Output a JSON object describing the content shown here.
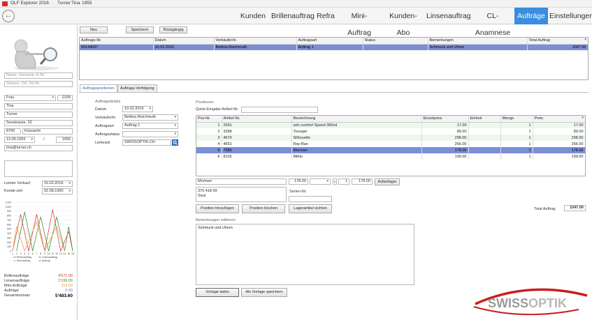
{
  "app": {
    "title": "OLF Explorer 2016",
    "user_last": "Turner",
    "user_first": "Tina",
    "user_year": "1955"
  },
  "nav": {
    "back_glyph": "←",
    "tabs": [
      {
        "label": "Kunden"
      },
      {
        "label": "Brillenauftrag"
      },
      {
        "label": "Refra"
      },
      {
        "label": "Mini-Auftrag"
      },
      {
        "label": "Kunden-Abo"
      },
      {
        "label": "Linsenauftrag"
      },
      {
        "label": "CL-Anamnese"
      },
      {
        "label": "Aufträge",
        "active": true
      },
      {
        "label": "Einstellungen"
      }
    ]
  },
  "customer": {
    "search_name_placeholder": "Name, Vorname, K-Nr.",
    "search_address_placeholder": "Strasse, Ort, Tel-Nr.",
    "salutation": "Frau",
    "number": "2109",
    "first_name": "Tina",
    "last_name": "Turner",
    "street": "Seestrasse. 22",
    "zip": "8700",
    "city": "Küsnacht",
    "birthdate": "13.06.1955",
    "slash": "/",
    "birth_year": "1955",
    "email": "tina@turner.ch",
    "last_purchase_label": "Letzter Verkauf",
    "last_purchase": "10.02.2016",
    "customer_since_label": "Kunde seit",
    "customer_since": "02.08.1990"
  },
  "mini_chart": {
    "y_ticks": [
      "1'100",
      "1'000",
      "900",
      "800",
      "700",
      "600",
      "500",
      "400",
      "300",
      "200",
      "100",
      "0"
    ],
    "x_ticks": [
      "1",
      "2",
      "3",
      "4",
      "5",
      "6",
      "7",
      "8",
      "9",
      "10",
      "11",
      "12",
      "13",
      "14",
      "15",
      "16"
    ],
    "legend": [
      {
        "name": "Brillenauftrag",
        "color": "#e03030"
      },
      {
        "name": "Linsenauftrag",
        "color": "#2e8b2e"
      },
      {
        "name": "Mini-Auftrag",
        "color": "#e89a3a"
      },
      {
        "name": "Auftrag",
        "color": "#9a5ad0"
      }
    ]
  },
  "summary": [
    {
      "label": "Brillenaufträge",
      "value": "4'571.00",
      "color": "#d43030"
    },
    {
      "label": "Linsenaufträge",
      "value": "1'199.00",
      "color": "#2e8b2e"
    },
    {
      "label": "Mini-Aufträge",
      "value": "113.60",
      "color": "#e89a3a"
    },
    {
      "label": "Aufträge",
      "value": "0.00",
      "color": "#9a5ad0"
    },
    {
      "label": "Gesamtumsatz",
      "value": "5'483.60",
      "color": "#000000",
      "bold": true
    }
  ],
  "toolbar": {
    "new": "Neu",
    "save": "Speichern",
    "undo": "Rückgängig"
  },
  "orders": {
    "headers": [
      "Auftrags-Nr.",
      "Datum",
      "Verkäufer/in",
      "Auftragsart",
      "Status",
      "Bemerkungen",
      "Total Auftrag"
    ],
    "rows": [
      [
        "99144067",
        "10.02.2016",
        "Bettina Reichmuth",
        "Auftrag 1",
        "",
        "Schmuck und Uhren",
        "1047.00"
      ]
    ]
  },
  "detail_tabs": {
    "positions": "Auftragspositionen",
    "tracking": "Auftrags-Verfolgung"
  },
  "order_details": {
    "group": "Auftragsdetails",
    "date_label": "Datum",
    "date": "10.02.2016",
    "seller_label": "Verkäufer/in",
    "seller": "Bettina Reichmuth",
    "type_label": "Auftragsart",
    "type": "Auftrag 1",
    "status_label": "Auftragsstatus",
    "status": "",
    "supplier_label": "Lieferant",
    "supplier": "SWISSOPTIK.CH"
  },
  "positions": {
    "group": "Positionen",
    "quick_label": "Quick-Eingabe Artikel-Nr.",
    "headers": [
      "Pos-Nr.",
      "Artikel-Nr.",
      "Bezeichnung",
      "Einzelpreis",
      "Einheit",
      "Menge",
      "Preis"
    ],
    "rows": [
      [
        "1",
        "2091",
        "seh.comfort Speed 360ml",
        "17.00",
        "",
        "1",
        "17.00"
      ],
      [
        "2",
        "3398",
        "Younger",
        "89.00",
        "",
        "1",
        "89.00"
      ],
      [
        "3",
        "4670",
        "Silhouette",
        "298.00",
        "",
        "1",
        "298.00"
      ],
      [
        "4",
        "4651",
        "Ray-Ban",
        "266.00",
        "",
        "1",
        "266.00"
      ],
      [
        "5",
        "7985",
        "Morman",
        "178.00",
        "",
        "1",
        "178.00"
      ],
      [
        "6",
        "8102",
        "Mitho",
        "199.00",
        "",
        "1",
        "199.00"
      ]
    ],
    "edit_name": "Morman",
    "edit_price": "178.00",
    "edit_qty": "1",
    "edit_total": "178.00",
    "stock_button": "Artikellager",
    "edit_note": "370 418 09\nSoul",
    "serial_label": "Serien-Nr.",
    "add_button": "Position hinzufügen",
    "delete_button": "Position löschen",
    "view_button": "Lagerartikel sichten",
    "total_label": "Total Auftrag",
    "total_value": "1047.00"
  },
  "remarks": {
    "group": "Bemerkungen editieren",
    "text": "Schmuck und Uhren",
    "load_button": "Vorlage laden",
    "save_button": "Als Vorlage speichern"
  },
  "brand": {
    "logo_text": "SWISSOPTIK",
    "logo_swiss": "SWISS",
    "logo_optik": "OPTIK"
  }
}
